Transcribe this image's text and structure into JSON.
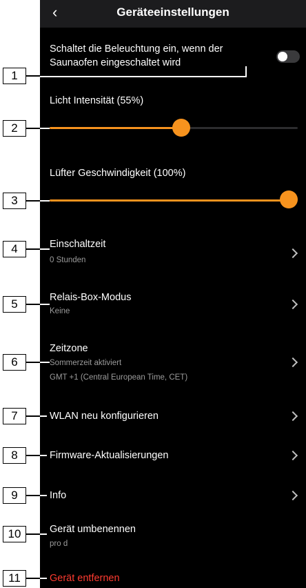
{
  "header": {
    "title": "Geräteeinstellungen",
    "back_icon": "chevron-left-icon"
  },
  "light_on_sauna": {
    "line1": "Schaltet die Beleuchtung ein, wenn der",
    "line2": "Saunaofen eingeschaltet wird",
    "enabled": false
  },
  "light_intensity": {
    "label": "Licht Intensität (55%)",
    "value_percent": 55
  },
  "fan_speed": {
    "label": "Lüfter Geschwindigkeit (100%)",
    "value_percent": 100
  },
  "menu": [
    {
      "label": "Einschaltzeit",
      "sub": "0 Stunden"
    },
    {
      "label": "Relais-Box-Modus",
      "sub": "Keine"
    },
    {
      "label": "Zeitzone",
      "sub": "Sommerzeit aktiviert",
      "sub2": "GMT +1 (Central European Time, CET)"
    },
    {
      "label": "WLAN neu konfigurieren"
    },
    {
      "label": "Firmware-Aktualisierungen"
    },
    {
      "label": "Info"
    },
    {
      "label": "Gerät umbenennen",
      "sub": "pro d"
    },
    {
      "label": "Gerät entfernen"
    }
  ],
  "callouts": [
    "1",
    "2",
    "3",
    "4",
    "5",
    "6",
    "7",
    "8",
    "9",
    "10",
    "11"
  ],
  "colors": {
    "accent": "#f7931e",
    "danger": "#ff3b30",
    "background": "#000000",
    "header": "#1c1c1e"
  }
}
